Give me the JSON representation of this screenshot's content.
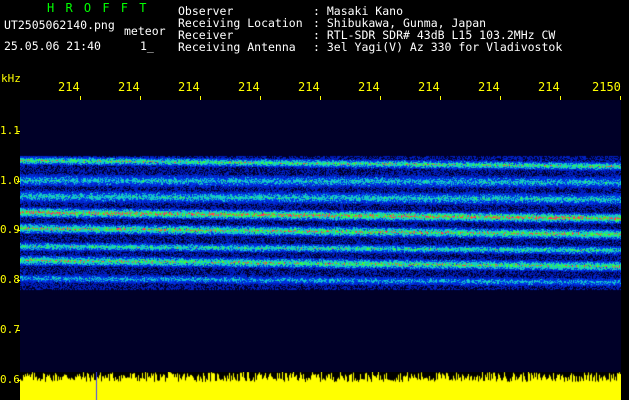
{
  "header": {
    "brand": "H R O F F T",
    "filename": "UT2505062140.png",
    "tag": "meteor",
    "datetime": "25.05.06 21:40",
    "page_marker": "1_",
    "labels": {
      "observer": "Observer",
      "location": "Receiving Location",
      "receiver": "Receiver",
      "antenna": "Receiving Antenna"
    },
    "values": {
      "observer": ": Masaki Kano",
      "location": ": Shibukawa, Gunma, Japan",
      "receiver": ": RTL-SDR SDR# 43dB L15 103.2MHz CW",
      "antenna": ": 3el Yagi(V) Az 330 for Vladivostok"
    }
  },
  "axes": {
    "y_unit": "kHz",
    "y_ticks": [
      "1.1",
      "1.0",
      "0.9",
      "0.8",
      "0.7",
      "0.6"
    ],
    "x_ticks": [
      "214",
      "214",
      "214",
      "214",
      "214",
      "214",
      "214",
      "214",
      "214",
      "2150"
    ]
  },
  "colors": {
    "text": "#ffffff",
    "brand": "#00ff00",
    "axis": "#ffff00",
    "background": "#000000"
  }
}
